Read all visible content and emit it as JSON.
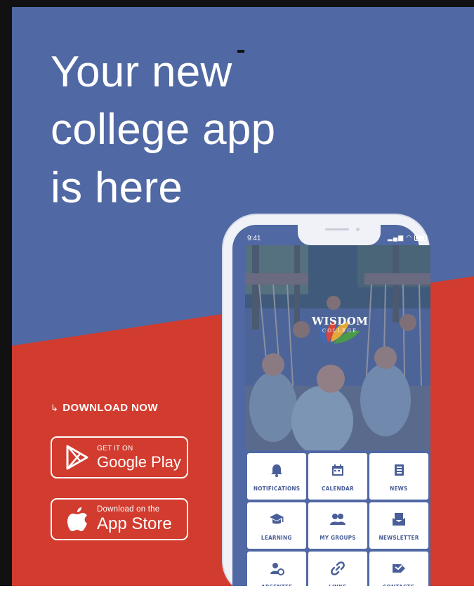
{
  "headline": {
    "line1": "Your new",
    "line2": "college app",
    "line3": "is here"
  },
  "download": {
    "label": "DOWNLOAD NOW",
    "google_play": {
      "small": "GET IT ON",
      "big": "Google Play"
    },
    "app_store": {
      "small": "Download on the",
      "big": "App Store"
    }
  },
  "phone": {
    "time": "9:41",
    "school": {
      "name": "WISDOM",
      "sub": "COLLEGE"
    },
    "tiles": [
      {
        "label": "NOTIFICATIONS",
        "icon": "bell-icon"
      },
      {
        "label": "CALENDAR",
        "icon": "calendar-icon"
      },
      {
        "label": "NEWS",
        "icon": "news-icon"
      },
      {
        "label": "LEARNING",
        "icon": "graduation-cap-icon"
      },
      {
        "label": "MY GROUPS",
        "icon": "group-icon"
      },
      {
        "label": "NEWSLETTER",
        "icon": "envelope-icon"
      },
      {
        "label": "ABSENTEE",
        "icon": "absentee-icon"
      },
      {
        "label": "LINKS",
        "icon": "link-icon"
      },
      {
        "label": "CONTACTS",
        "icon": "contact-icon"
      }
    ]
  },
  "colors": {
    "blue": "#5068a3",
    "red": "#d13c2f",
    "tile_icon": "#4a5f99",
    "white": "#ffffff"
  }
}
